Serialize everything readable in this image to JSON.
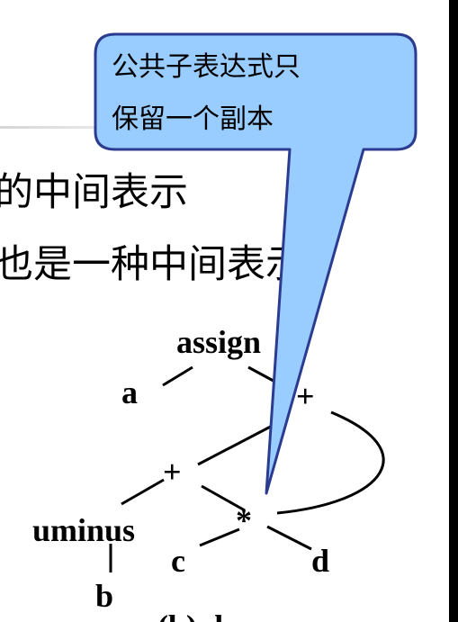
{
  "body": {
    "line1": "的中间表示",
    "line2": "也是一种中间表示"
  },
  "tree": {
    "assign": "assign",
    "a": "a",
    "plus_top": "+",
    "plus_mid": "+",
    "times": "*",
    "uminus": "uminus",
    "b": "b",
    "c": "c",
    "d": "d",
    "caption": "(b) d"
  },
  "callout": {
    "line1": "公共子表达式只",
    "line2": "保留一个副本",
    "fill": "#99ccff",
    "border": "#2b3b8f"
  }
}
